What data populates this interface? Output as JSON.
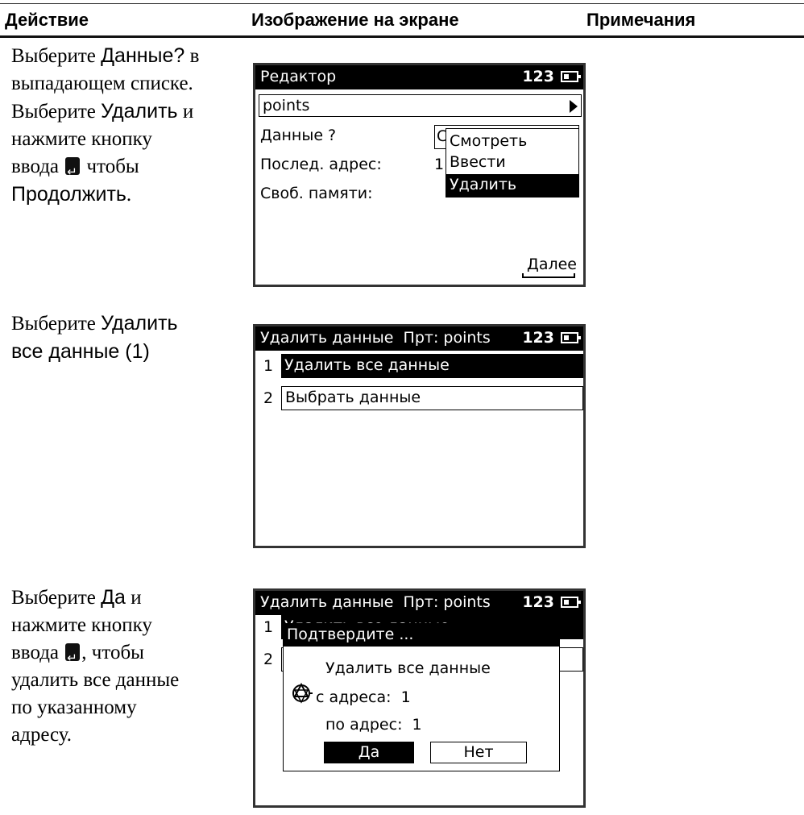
{
  "table_header": {
    "col_action": "Действие",
    "col_screen": "Изображение на экране",
    "col_notes": "Примечания"
  },
  "rows": [
    {
      "instructions": {
        "l1a": "Выберите ",
        "l1b": "Данные?",
        "l1c": " в",
        "l2": "выпадающем списке.",
        "l3a": "Выберите ",
        "l3b": "Удалить",
        "l3c": " и",
        "l4": "нажмите кнопку",
        "l5a": "ввода ",
        "l5b": " чтобы",
        "l6": "Продолжить",
        "l6b": "."
      },
      "screen": {
        "title": "Редактор",
        "indicator": "123",
        "job_value": "points",
        "label_data": "Данные ?",
        "label_last_addr": "Послед. адрес:",
        "label_free_mem": "Своб. памяти:",
        "data_value_partial": "С",
        "last_addr_partial": "1",
        "dropdown": [
          "Смотреть",
          "Ввести",
          "Удалить"
        ],
        "softkey": "Далее"
      }
    },
    {
      "instructions": {
        "l1a": "Выберите ",
        "l1b": "Удалить",
        "l2": "все данные (1)"
      },
      "screen": {
        "title": "Удалить данные  Прт: points",
        "indicator": "123",
        "menu": [
          {
            "num": "1",
            "label": "Удалить все данные"
          },
          {
            "num": "2",
            "label": "Выбрать данные"
          }
        ]
      }
    },
    {
      "instructions": {
        "l1a": "Выберите ",
        "l1b": "Да",
        "l1c": " и",
        "l2": "нажмите кнопку",
        "l3a": "ввода ",
        "l3b": ", чтобы",
        "l4": "удалить все данные",
        "l5": "по указанному",
        "l6": "адресу."
      },
      "screen": {
        "title": "Удалить данные  Прт: points",
        "indicator": "123",
        "bg_item1_num": "1",
        "bg_item1_label": "Удалить все данные",
        "bg_item2_num": "2",
        "dialog_title": "Подтвердите ...",
        "dialog_line1": "Удалить все данные",
        "dialog_from": "с адреса:  1",
        "dialog_to": "по адрес:  1",
        "yes": "Да",
        "no": "Нет"
      }
    }
  ]
}
